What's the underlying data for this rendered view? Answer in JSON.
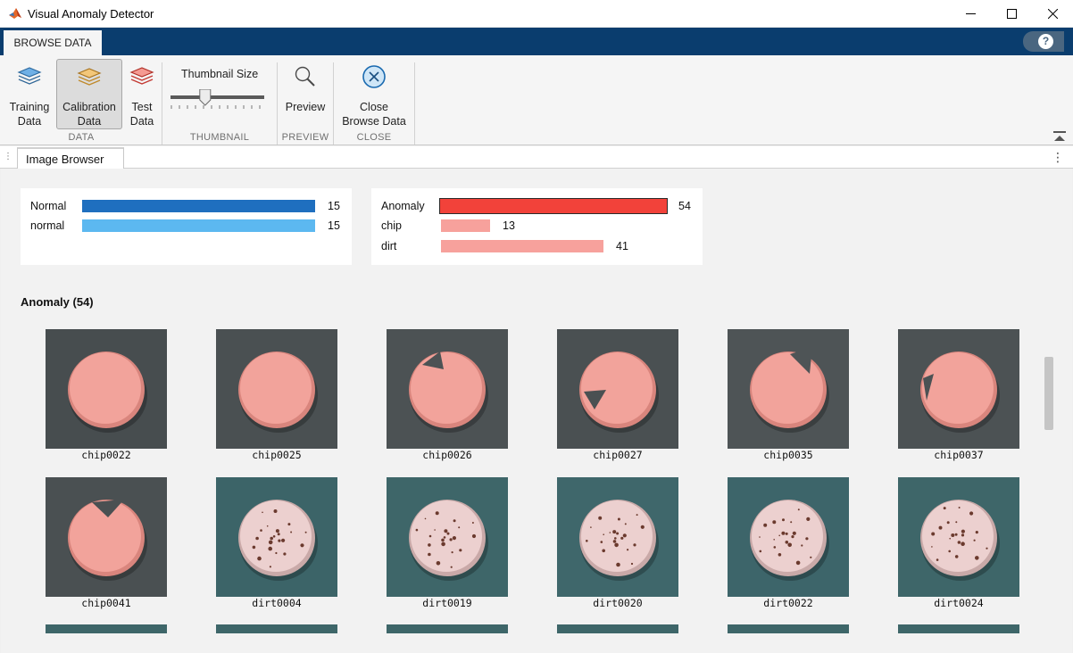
{
  "window": {
    "title": "Visual Anomaly Detector",
    "icon": "matlab-logo"
  },
  "ribbon": {
    "tab": "BROWSE DATA",
    "help_icon": "?",
    "buttons": {
      "training": [
        "Training",
        "Data"
      ],
      "calibration": [
        "Calibration",
        "Data"
      ],
      "test": [
        "Test",
        "Data"
      ],
      "preview": "Preview",
      "close": [
        "Close",
        "Browse Data"
      ]
    },
    "selected_button": "calibration",
    "thumbnail_size_label": "Thumbnail Size",
    "thumbnail_size_fraction": 0.22,
    "sections": {
      "data": "DATA",
      "thumbnail": "THUMBNAIL",
      "preview": "PREVIEW",
      "close": "CLOSE"
    }
  },
  "document_tab": "Image Browser",
  "summary": {
    "normal_panel": [
      {
        "label": "Normal",
        "count": "15",
        "color": "#1f6fbf"
      },
      {
        "label": "normal",
        "count": "15",
        "color": "#5cb8f0"
      }
    ],
    "anomaly_panel": [
      {
        "label": "Anomaly",
        "count": "54",
        "color": "#f2423a"
      },
      {
        "label": "chip",
        "count": "13",
        "color": "#f7a19c"
      },
      {
        "label": "dirt",
        "count": "41",
        "color": "#f7a19c"
      }
    ]
  },
  "group_title": "Anomaly (54)",
  "thumbnails": [
    {
      "name": "chip0022",
      "kind": "chip",
      "bg": "#474d4f"
    },
    {
      "name": "chip0025",
      "kind": "chip",
      "bg": "#4a5052"
    },
    {
      "name": "chip0026",
      "kind": "chip",
      "bg": "#4c5254"
    },
    {
      "name": "chip0027",
      "kind": "chip",
      "bg": "#4a5052"
    },
    {
      "name": "chip0035",
      "kind": "chip",
      "bg": "#4e5456"
    },
    {
      "name": "chip0037",
      "kind": "chip",
      "bg": "#4c5254"
    },
    {
      "name": "chip0041",
      "kind": "chip",
      "bg": "#4a5052"
    },
    {
      "name": "dirt0004",
      "kind": "dirt",
      "bg": "#3c6468"
    },
    {
      "name": "dirt0019",
      "kind": "dirt",
      "bg": "#3e6669"
    },
    {
      "name": "dirt0020",
      "kind": "dirt",
      "bg": "#3f676b"
    },
    {
      "name": "dirt0022",
      "kind": "dirt",
      "bg": "#3d656a"
    },
    {
      "name": "dirt0024",
      "kind": "dirt",
      "bg": "#3e6669"
    }
  ]
}
